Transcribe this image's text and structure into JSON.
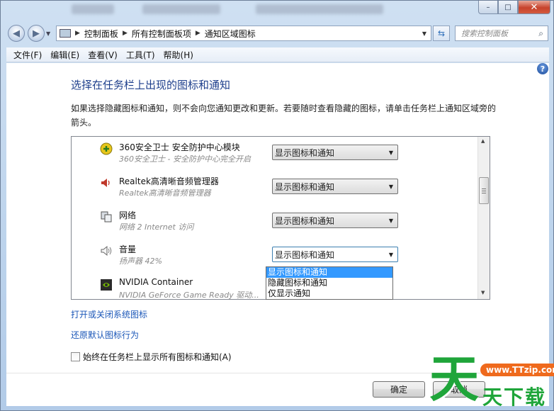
{
  "window": {
    "caption_buttons": {
      "minimize": "–",
      "maximize": "□",
      "close": "✕"
    }
  },
  "address": {
    "crumbs": [
      "控制面板",
      "所有控制面板项",
      "通知区域图标"
    ],
    "search_placeholder": "搜索控制面板"
  },
  "menu": [
    "文件(F)",
    "编辑(E)",
    "查看(V)",
    "工具(T)",
    "帮助(H)"
  ],
  "page": {
    "title": "选择在任务栏上出现的图标和通知",
    "description": "如果选择隐藏图标和通知，则不会向您通知更改和更新。若要随时查看隐藏的图标，请单击任务栏上通知区域旁的箭头。"
  },
  "rows": [
    {
      "name": "360安全卫士 安全防护中心模块",
      "sub": "360安全卫士 - 安全防护中心完全开启",
      "behavior": "显示图标和通知",
      "icon": "shield-360-icon"
    },
    {
      "name": "Realtek高清晰音频管理器",
      "sub": "Realtek高清晰音频管理器",
      "behavior": "显示图标和通知",
      "icon": "speaker-red-icon"
    },
    {
      "name": "网络",
      "sub": "网络 2 Internet 访问",
      "behavior": "显示图标和通知",
      "icon": "network-icon"
    },
    {
      "name": "音量",
      "sub": "扬声器 42%",
      "behavior": "显示图标和通知",
      "icon": "volume-icon"
    },
    {
      "name": "NVIDIA Container",
      "sub": "NVIDIA GeForce Game Ready 驱动...",
      "behavior": "",
      "icon": "nvidia-icon"
    }
  ],
  "dropdown_options": [
    "显示图标和通知",
    "隐藏图标和通知",
    "仅显示通知"
  ],
  "dropdown_selected_index": 0,
  "links": {
    "system_icons": "打开或关闭系统图标",
    "restore": "还原默认图标行为"
  },
  "checkbox": {
    "label": "始终在任务栏上显示所有图标和通知(A)",
    "checked": false
  },
  "buttons": {
    "ok": "确定",
    "cancel": "取消"
  },
  "watermark": {
    "big": "天",
    "pill": "www.TTzip.com",
    "small": "天下载"
  },
  "colors": {
    "link": "#1b57b8",
    "title": "#1e3f8c",
    "selection": "#3399ff",
    "watermark_green": "#1fa53a",
    "watermark_orange": "#ef6a1d"
  }
}
